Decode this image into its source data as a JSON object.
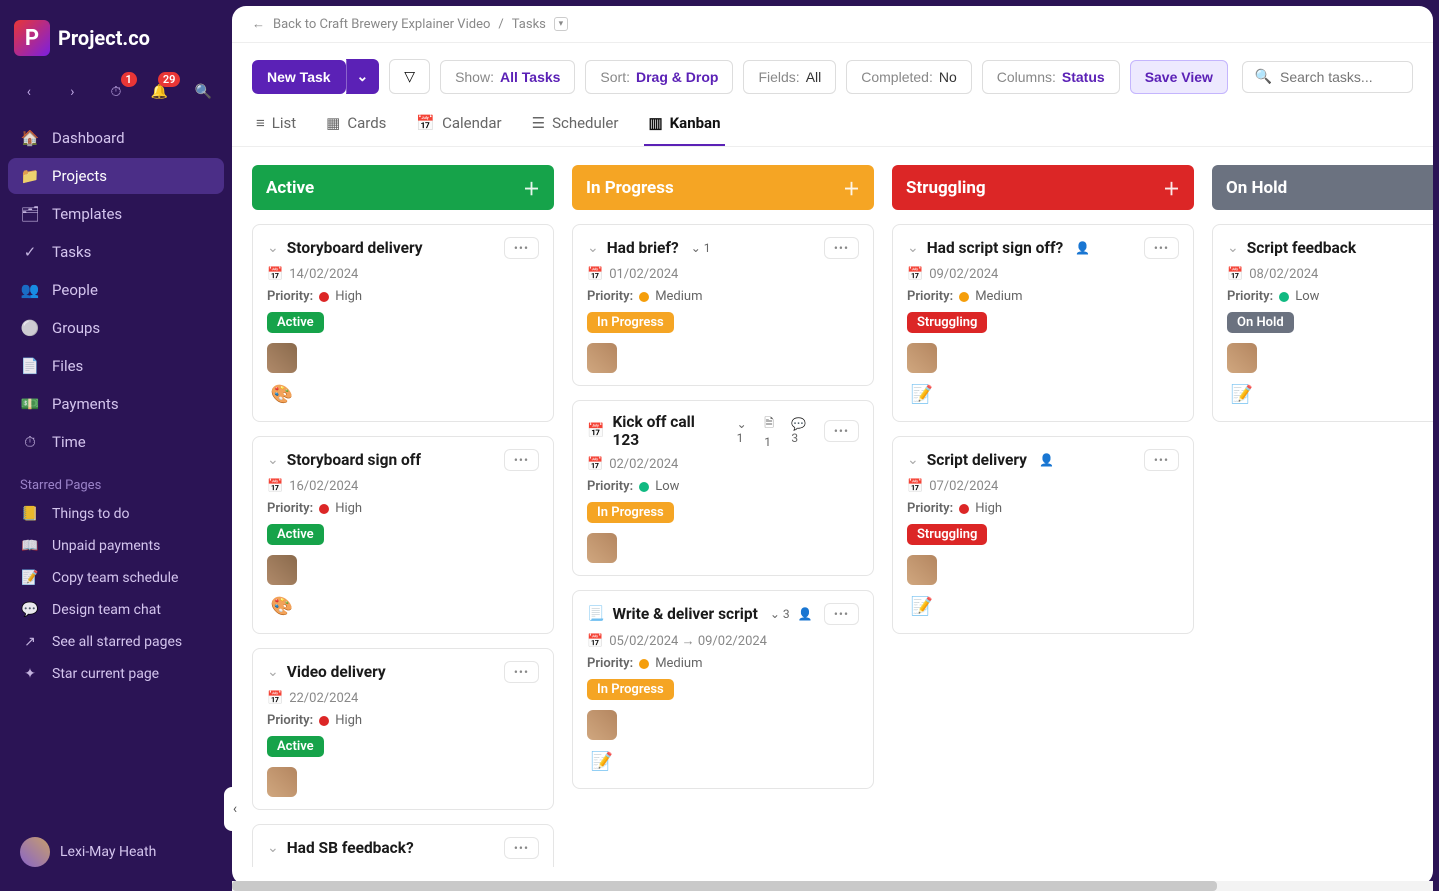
{
  "brand": "Project.co",
  "top_badges": {
    "timer": "1",
    "bell": "29"
  },
  "nav": [
    {
      "icon": "🏠",
      "label": "Dashboard"
    },
    {
      "icon": "📁",
      "label": "Projects",
      "active": true
    },
    {
      "icon": "🗂",
      "label": "Templates"
    },
    {
      "icon": "✓",
      "label": "Tasks"
    },
    {
      "icon": "👥",
      "label": "People"
    },
    {
      "icon": "⚪",
      "label": "Groups"
    },
    {
      "icon": "📄",
      "label": "Files"
    },
    {
      "icon": "💵",
      "label": "Payments"
    },
    {
      "icon": "⏱",
      "label": "Time"
    }
  ],
  "starred_label": "Starred Pages",
  "starred": [
    {
      "icon": "📒",
      "label": "Things to do"
    },
    {
      "icon": "📖",
      "label": "Unpaid payments"
    },
    {
      "icon": "📝",
      "label": "Copy team schedule"
    },
    {
      "icon": "💬",
      "label": "Design team chat"
    },
    {
      "icon": "↗",
      "label": "See all starred pages"
    },
    {
      "icon": "✦",
      "label": "Star current page"
    }
  ],
  "user_name": "Lexi-May Heath",
  "breadcrumb": {
    "back": "Back to Craft Brewery Explainer Video",
    "current": "Tasks"
  },
  "toolbar": {
    "new_task": "New Task",
    "show_k": "Show:",
    "show_v": "All Tasks",
    "sort_k": "Sort:",
    "sort_v": "Drag & Drop",
    "fields_k": "Fields:",
    "fields_v": "All",
    "completed_k": "Completed:",
    "completed_v": "No",
    "columns_k": "Columns:",
    "columns_v": "Status",
    "save_view": "Save View",
    "search_placeholder": "Search tasks..."
  },
  "views": [
    {
      "icon": "≡",
      "label": "List"
    },
    {
      "icon": "▦",
      "label": "Cards"
    },
    {
      "icon": "📅",
      "label": "Calendar"
    },
    {
      "icon": "☰",
      "label": "Scheduler"
    },
    {
      "icon": "▥",
      "label": "Kanban",
      "active": true
    }
  ],
  "priority_label": "Priority:",
  "columns": [
    {
      "key": "active",
      "title": "Active",
      "class": "active",
      "pill": "pill-active",
      "pill_label": "Active",
      "cards": [
        {
          "icon": "",
          "title": "Storyboard delivery",
          "date": "14/02/2024",
          "priority": "High",
          "dot": "high",
          "avatars": [
            "a"
          ],
          "emoji": "🎨"
        },
        {
          "icon": "",
          "title": "Storyboard sign off",
          "date": "16/02/2024",
          "priority": "High",
          "dot": "high",
          "avatars": [
            "a"
          ],
          "emoji": "🎨"
        },
        {
          "icon": "",
          "title": "Video delivery",
          "date": "22/02/2024",
          "priority": "High",
          "dot": "high",
          "avatars": [
            "b"
          ]
        },
        {
          "icon": "",
          "title": "Had SB feedback?",
          "date": "",
          "priority": "",
          "dot": "",
          "avatars": []
        }
      ]
    },
    {
      "key": "progress",
      "title": "In Progress",
      "class": "progress",
      "pill": "pill-progress",
      "pill_label": "In Progress",
      "cards": [
        {
          "icon": "",
          "title": "Had brief?",
          "chips": [
            {
              "t": "sub",
              "v": "1"
            }
          ],
          "date": "01/02/2024",
          "priority": "Medium",
          "dot": "med",
          "avatars": [
            "b"
          ]
        },
        {
          "icon": "📅",
          "title": "Kick off call 123",
          "chips": [
            {
              "t": "sub",
              "v": "1"
            },
            {
              "t": "file",
              "v": "1"
            },
            {
              "t": "chat",
              "v": "3"
            }
          ],
          "date": "02/02/2024",
          "priority": "Low",
          "dot": "low",
          "avatars": [
            "b"
          ]
        },
        {
          "icon": "📃",
          "title": "Write & deliver script",
          "chips": [
            {
              "t": "sub",
              "v": "3"
            },
            {
              "t": "user",
              "v": ""
            }
          ],
          "date": "05/02/2024 → 09/02/2024",
          "priority": "Medium",
          "dot": "med",
          "avatars": [
            "b"
          ],
          "emoji": "📝"
        }
      ]
    },
    {
      "key": "struggling",
      "title": "Struggling",
      "class": "struggling",
      "pill": "pill-struggling",
      "pill_label": "Struggling",
      "cards": [
        {
          "icon": "",
          "title": "Had script sign off?",
          "chips": [
            {
              "t": "user",
              "v": ""
            }
          ],
          "date": "09/02/2024",
          "priority": "Medium",
          "dot": "med",
          "avatars": [
            "b"
          ],
          "emoji": "📝"
        },
        {
          "icon": "",
          "title": "Script delivery",
          "chips": [
            {
              "t": "user",
              "v": ""
            }
          ],
          "date": "07/02/2024",
          "priority": "High",
          "dot": "high",
          "avatars": [
            "b"
          ],
          "emoji": "📝"
        }
      ]
    },
    {
      "key": "hold",
      "title": "On Hold",
      "class": "hold",
      "pill": "pill-hold",
      "pill_label": "On Hold",
      "cards": [
        {
          "icon": "",
          "title": "Script feedback",
          "date": "08/02/2024",
          "priority": "Low",
          "dot": "low",
          "avatars": [
            "b"
          ],
          "emoji": "📝"
        }
      ]
    }
  ]
}
